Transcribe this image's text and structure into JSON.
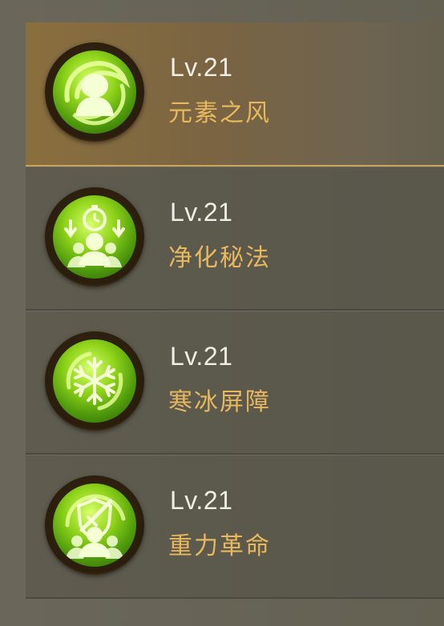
{
  "skills": [
    {
      "level": "Lv.21",
      "name": "元素之风",
      "icon": "wind-spirit-icon",
      "selected": true
    },
    {
      "level": "Lv.21",
      "name": "净化秘法",
      "icon": "purify-timer-icon",
      "selected": false
    },
    {
      "level": "Lv.21",
      "name": "寒冰屏障",
      "icon": "snowflake-icon",
      "selected": false
    },
    {
      "level": "Lv.21",
      "name": "重力革命",
      "icon": "shield-sword-icon",
      "selected": false
    }
  ],
  "colors": {
    "background": "#6d6a5c",
    "level_text": "#f1eee6",
    "name_text": "#e7b85d",
    "icon_green": "#8fd31a",
    "selected_highlight": "#8a6f3e"
  }
}
